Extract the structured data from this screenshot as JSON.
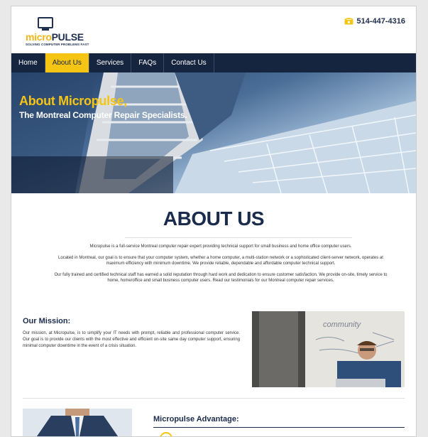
{
  "brand": {
    "logo_word_1": "micro",
    "logo_word_2": "PULSE",
    "tagline": "SOLVING COMPUTER PROBLEMS FAST",
    "phone_icon": "phone-icon",
    "phone": "514-447-4316",
    "accent": "#f6c413",
    "navy": "#16253f"
  },
  "nav": {
    "items": [
      {
        "label": "Home",
        "active": false
      },
      {
        "label": "About Us",
        "active": true
      },
      {
        "label": "Services",
        "active": false
      },
      {
        "label": "FAQs",
        "active": false
      },
      {
        "label": "Contact Us",
        "active": false
      }
    ]
  },
  "hero": {
    "title": "About Micropulse,",
    "subtitle": "The Montreal Computer Repair Specialists."
  },
  "about": {
    "heading": "ABOUT US",
    "paragraphs": [
      "Micropulse is a full-service Montreal computer repair expert providing technical support for small business and home office computer users.",
      "Located in Montreal, our goal is to ensure that your computer system, whether a home computer, a multi-station network or a sophisticated client-server network, operates at maximum efficiency with minimum downtime. We provide reliable, dependable and affordable computer technical support.",
      "Our fully trained and certified technical staff has earned a solid reputation through hard work and dedication to ensure customer satisfaction. We provide on-site, timely service to home, home/office and small business computer users. Read our testimonials for our Montreal computer repair services."
    ]
  },
  "mission": {
    "title": "Our Mission:",
    "text": "Our mission, at Micropulse, is to simplify your IT needs with prompt, reliable and professional computer service. Our goal is to provide our clients with the most effective and efficient on-site same day computer support, ensuring minimal computer downtime in the event of a crisis situation.",
    "photo_text": "community"
  },
  "advantage": {
    "title": "Micropulse Advantage:"
  }
}
